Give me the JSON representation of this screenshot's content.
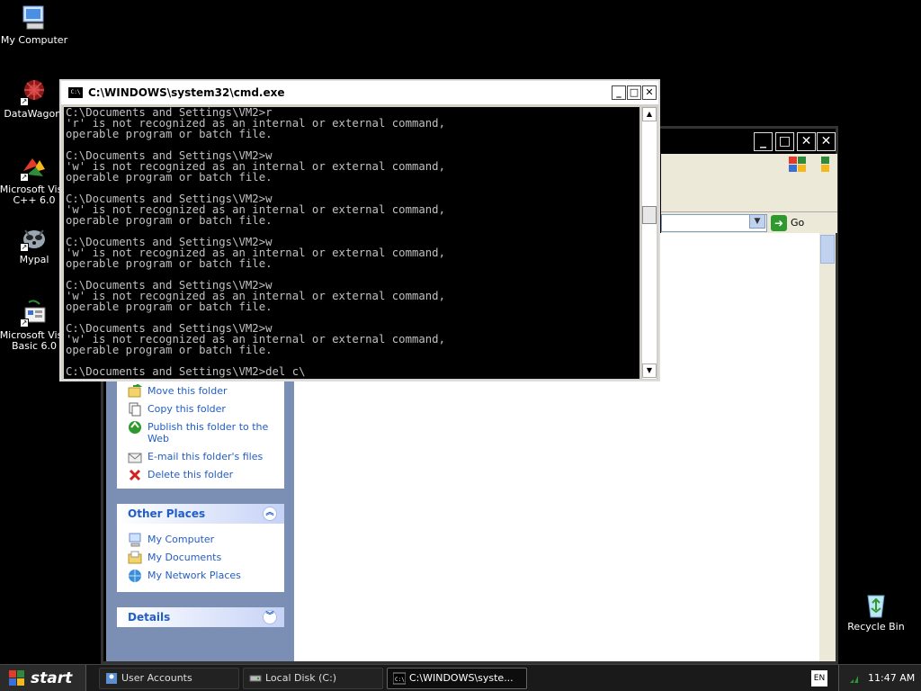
{
  "desktop": {
    "icons": [
      {
        "label": "My Computer",
        "icon": "my-computer-icon"
      },
      {
        "label": "DataWagon.",
        "icon": "datawagon-icon"
      },
      {
        "label": "Microsoft Visual C++ 6.0",
        "label_l1": "Microsoft Visu",
        "label_l2": "C++ 6.0",
        "icon": "visual-cpp-icon"
      },
      {
        "label": "Mypal",
        "icon": "mypal-icon"
      },
      {
        "label": "Microsoft Visual Basic 6.0",
        "label_l1": "Microsoft Visu",
        "label_l2": "Basic 6.0",
        "icon": "visual-basic-icon"
      },
      {
        "label": "Recycle Bin",
        "icon": "recycle-bin-icon"
      }
    ]
  },
  "cmd": {
    "title": "C:\\WINDOWS\\system32\\cmd.exe",
    "minimize": "_",
    "maximize": "□",
    "close": "✕",
    "lines": [
      "C:\\Documents and Settings\\VM2>r",
      "'r' is not recognized as an internal or external command,",
      "operable program or batch file.",
      "",
      "C:\\Documents and Settings\\VM2>w",
      "'w' is not recognized as an internal or external command,",
      "operable program or batch file.",
      "",
      "C:\\Documents and Settings\\VM2>w",
      "'w' is not recognized as an internal or external command,",
      "operable program or batch file.",
      "",
      "C:\\Documents and Settings\\VM2>w",
      "'w' is not recognized as an internal or external command,",
      "operable program or batch file.",
      "",
      "C:\\Documents and Settings\\VM2>w",
      "'w' is not recognized as an internal or external command,",
      "operable program or batch file.",
      "",
      "C:\\Documents and Settings\\VM2>w",
      "'w' is not recognized as an internal or external command,",
      "operable program or batch file.",
      "",
      "C:\\Documents and Settings\\VM2>del c\\"
    ]
  },
  "explorer": {
    "go_label": "Go",
    "file_tasks": [
      {
        "label": "Move this folder",
        "icon": "move-folder-icon"
      },
      {
        "label": "Copy this folder",
        "icon": "copy-folder-icon"
      },
      {
        "label": "Publish this folder to the Web",
        "label_l1": "Publish this folder to the",
        "label_l2": "Web",
        "icon": "publish-web-icon"
      },
      {
        "label": "E-mail this folder's files",
        "icon": "email-icon"
      },
      {
        "label": "Delete this folder",
        "icon": "delete-icon"
      }
    ],
    "other_places": {
      "title": "Other Places",
      "items": [
        {
          "label": "My Computer",
          "icon": "my-computer-icon"
        },
        {
          "label": "My Documents",
          "icon": "my-documents-icon"
        },
        {
          "label": "My Network Places",
          "icon": "network-places-icon"
        }
      ]
    },
    "details": {
      "title": "Details"
    }
  },
  "taskbar": {
    "start_label": "start",
    "buttons": [
      {
        "label": "User Accounts",
        "icon": "user-accounts-icon"
      },
      {
        "label": "Local Disk (C:)",
        "icon": "local-disk-icon"
      },
      {
        "label": "C:\\WINDOWS\\syste...",
        "icon": "cmd-icon",
        "active": true
      }
    ],
    "language": "EN",
    "clock": "11:47 AM"
  }
}
